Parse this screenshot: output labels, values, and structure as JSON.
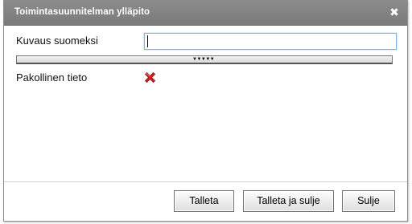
{
  "dialog": {
    "title": "Toimintasuunnitelman ylläpito",
    "close_glyph": "✖"
  },
  "form": {
    "description_label": "Kuvaus suomeksi",
    "description_value": "",
    "expander_glyph": "▼▼▼▼▼",
    "required_label": "Pakollinen tieto",
    "required_status_icon": "red-x-icon"
  },
  "buttons": {
    "save": "Talleta",
    "save_and_close": "Talleta ja sulje",
    "close": "Sulje"
  },
  "colors": {
    "titlebar": "#808080",
    "input_focus_border": "#7fb2e6",
    "required_icon": "#d81e1e"
  }
}
